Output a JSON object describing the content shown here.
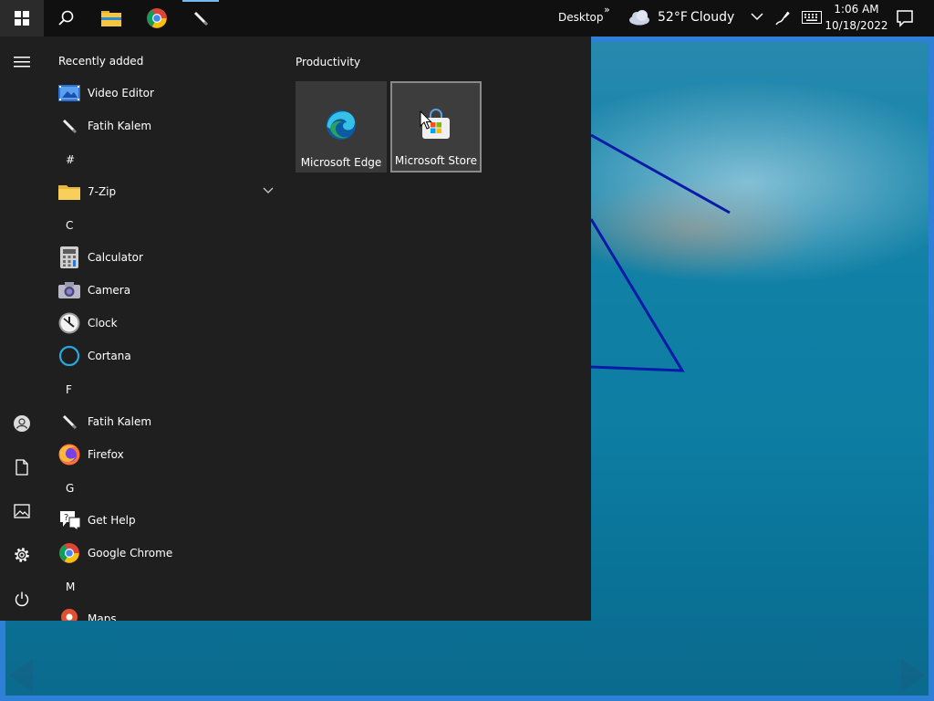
{
  "taskbar": {
    "desktop_label": "Desktop",
    "overflow_glyph": "»",
    "weather_temp": "52°F",
    "weather_condition": "Cloudy",
    "time": "1:06 AM",
    "date": "10/18/2022",
    "icons": [
      "windows-logo-icon",
      "search-icon",
      "file-explorer-icon",
      "chrome-icon",
      "pen-icon",
      "cloud-icon",
      "chevron-up-icon",
      "pen-workspace-icon",
      "touch-keyboard-icon",
      "notification-icon"
    ]
  },
  "start_menu": {
    "recently_added_header": "Recently added",
    "recently_added": [
      {
        "label": "Video Editor",
        "icon": "video-editor-icon"
      },
      {
        "label": "Fatih Kalem",
        "icon": "pen-icon"
      }
    ],
    "sections": [
      {
        "letter": "#",
        "apps": [
          {
            "label": "7-Zip",
            "icon": "folder-icon"
          }
        ]
      },
      {
        "letter": "C",
        "apps": [
          {
            "label": "Calculator",
            "icon": "calculator-icon"
          },
          {
            "label": "Camera",
            "icon": "camera-icon"
          },
          {
            "label": "Clock",
            "icon": "clock-icon"
          },
          {
            "label": "Cortana",
            "icon": "cortana-icon"
          }
        ]
      },
      {
        "letter": "F",
        "apps": [
          {
            "label": "Fatih Kalem",
            "icon": "pen-icon"
          },
          {
            "label": "Firefox",
            "icon": "firefox-icon"
          }
        ]
      },
      {
        "letter": "G",
        "apps": [
          {
            "label": "Get Help",
            "icon": "help-icon"
          },
          {
            "label": "Google Chrome",
            "icon": "chrome-icon"
          }
        ]
      },
      {
        "letter": "M",
        "apps": [
          {
            "label": "Maps",
            "icon": "maps-icon"
          }
        ]
      }
    ],
    "rail_icons": [
      "hamburger-menu-icon",
      "user-icon",
      "documents-icon",
      "pictures-icon",
      "settings-icon",
      "power-icon"
    ],
    "tile_group": {
      "title": "Productivity",
      "tiles": [
        {
          "label": "Microsoft Edge",
          "icon": "edge-icon"
        },
        {
          "label": "Microsoft Store",
          "icon": "store-icon"
        }
      ]
    }
  },
  "colors": {
    "taskbar_bg": "#101010",
    "start_bg": "#1f1f1f",
    "tile_bg": "#393939",
    "accent": "#2e7fd6",
    "annotation_line": "#0a1aa8"
  }
}
